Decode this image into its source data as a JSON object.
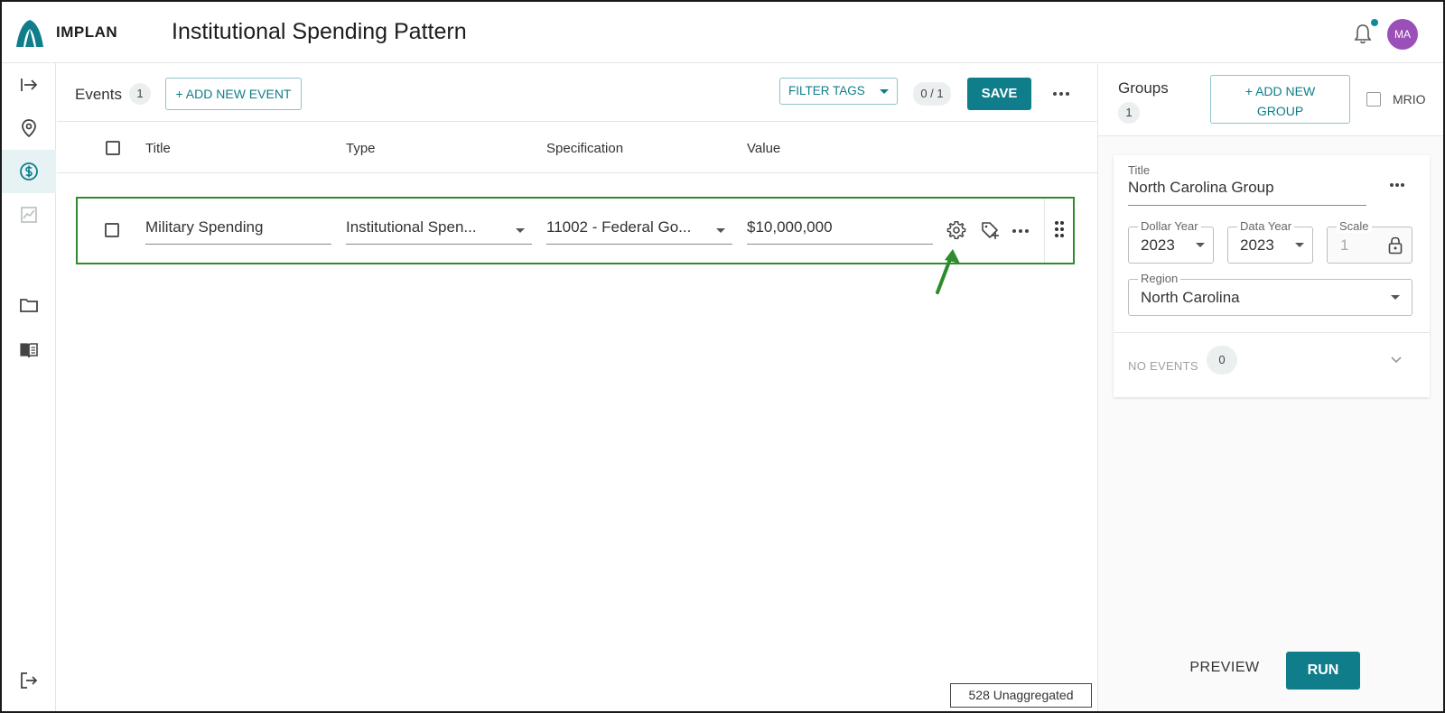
{
  "app": {
    "brand": "IMPLAN",
    "page_title": "Institutional Spending Pattern",
    "avatar_initials": "MA",
    "accent_color": "#0f7d8a",
    "avatar_color": "#9b4fb8",
    "highlight_color": "#2e8b2e"
  },
  "rail": {
    "items": [
      {
        "icon": "expand-arrow-icon"
      },
      {
        "icon": "location-pin-icon"
      },
      {
        "icon": "dollar-circle-icon",
        "active": true
      },
      {
        "icon": "chart-icon"
      },
      {
        "icon": "folder-icon"
      },
      {
        "icon": "book-icon"
      },
      {
        "icon": "logout-icon"
      }
    ]
  },
  "events": {
    "label": "Events",
    "count": "1",
    "add_button": "+ ADD NEW EVENT",
    "filter_tags": "FILTER TAGS",
    "selection_count": "0 / 1",
    "save_button": "SAVE",
    "columns": [
      "Title",
      "Type",
      "Specification",
      "Value"
    ],
    "rows": [
      {
        "title": "Military Spending",
        "type": "Institutional Spen...",
        "specification": "11002 - Federal Go...",
        "value": "$10,000,000"
      }
    ]
  },
  "groups": {
    "label": "Groups",
    "count": "1",
    "add_button_line1": "+ ADD NEW",
    "add_button_line2": "GROUP",
    "mrio_label": "MRIO",
    "card": {
      "title_label": "Title",
      "title_value": "North Carolina Group",
      "dollar_year_label": "Dollar Year",
      "dollar_year_value": "2023",
      "data_year_label": "Data Year",
      "data_year_value": "2023",
      "scale_label": "Scale",
      "scale_value": "1",
      "region_label": "Region",
      "region_value": "North Carolina",
      "no_events_label": "NO EVENTS",
      "no_events_count": "0"
    }
  },
  "footer": {
    "preview_button": "PREVIEW",
    "run_button": "RUN",
    "status": "528 Unaggregated"
  }
}
